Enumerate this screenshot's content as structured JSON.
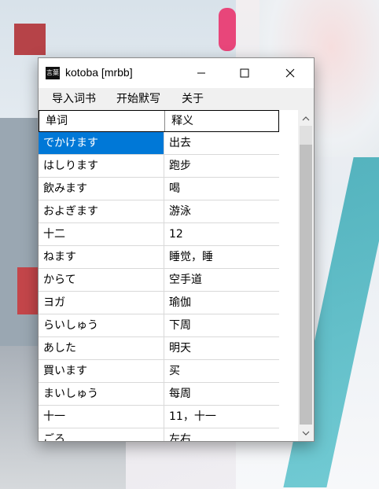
{
  "window": {
    "title": "kotoba [mrbb]",
    "icon_label": "言葉",
    "controls": {
      "minimize": "minimize-icon",
      "maximize": "maximize-icon",
      "close": "close-icon"
    }
  },
  "menu": {
    "items": [
      {
        "label": "导入词书"
      },
      {
        "label": "开始默写"
      },
      {
        "label": "关于"
      }
    ]
  },
  "table": {
    "headers": {
      "word": "单词",
      "meaning": "释义"
    },
    "rows": [
      {
        "word": "でかけます",
        "meaning": "出去",
        "selected": true
      },
      {
        "word": "はしります",
        "meaning": "跑步"
      },
      {
        "word": "飲みます",
        "meaning": "喝"
      },
      {
        "word": "およぎます",
        "meaning": "游泳"
      },
      {
        "word": "十二",
        "meaning": "12"
      },
      {
        "word": "ねます",
        "meaning": "睡觉，睡"
      },
      {
        "word": "からて",
        "meaning": "空手道"
      },
      {
        "word": "ヨガ",
        "meaning": "瑜伽"
      },
      {
        "word": "らいしゅう",
        "meaning": "下周"
      },
      {
        "word": "あした",
        "meaning": "明天"
      },
      {
        "word": "買います",
        "meaning": "买"
      },
      {
        "word": "まいしゅう",
        "meaning": "每周"
      },
      {
        "word": "十一",
        "meaning": "11，十一"
      },
      {
        "word": "ごろ",
        "meaning": "左右"
      }
    ]
  },
  "colors": {
    "selection": "#0078d7",
    "scroll_track": "#c0c0c0"
  }
}
